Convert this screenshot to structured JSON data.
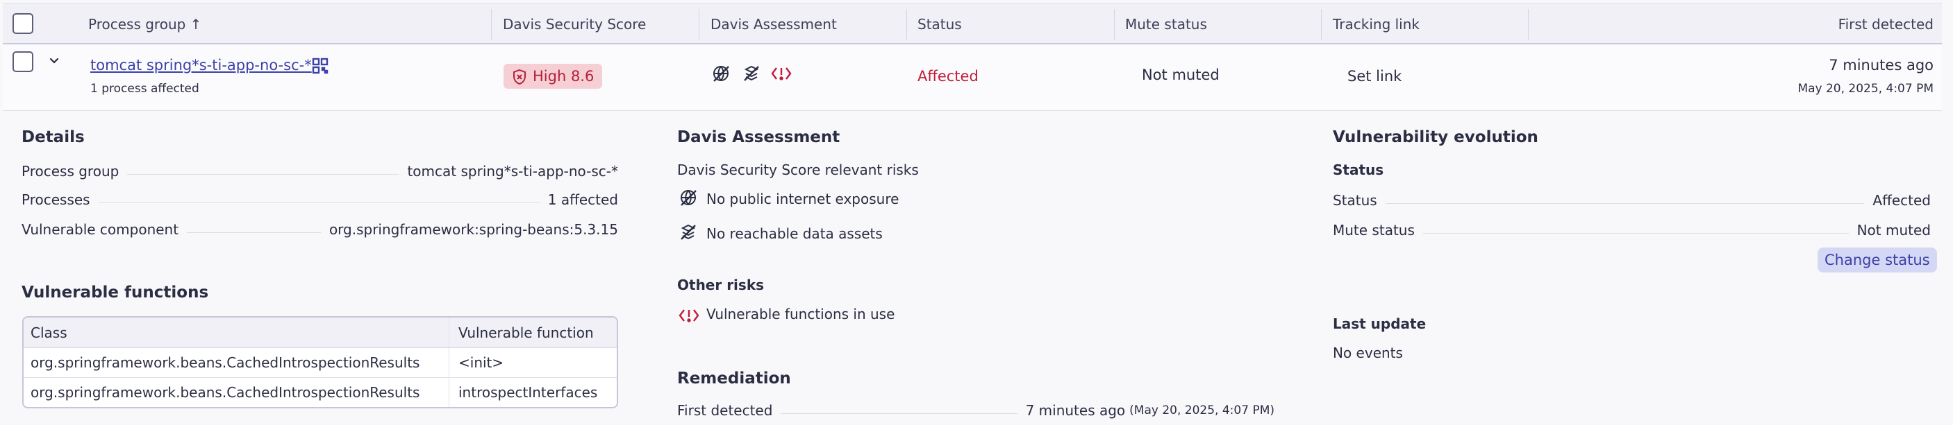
{
  "table": {
    "columns": {
      "process_group": "Process group ↑",
      "score": "Davis Security Score",
      "assessment": "Davis Assessment",
      "status": "Status",
      "mute": "Mute status",
      "tracking": "Tracking link",
      "first_detected": "First detected"
    },
    "row": {
      "name": "tomcat spring*s-ti-app-no-sc-*",
      "processes": "1 process affected",
      "score_label": "High 8.6",
      "status": "Affected",
      "mute": "Not muted",
      "tracking": "Set link",
      "detected_relative": "7 minutes ago",
      "detected_date": "May 20, 2025, 4:07 PM"
    }
  },
  "details": {
    "title": "Details",
    "process_group_label": "Process group",
    "process_group_value": "tomcat spring*s-ti-app-no-sc-*",
    "processes_label": "Processes",
    "processes_value": "1 affected",
    "component_label": "Vulnerable component",
    "component_value": "org.springframework:spring-beans:5.3.15"
  },
  "functions": {
    "title": "Vulnerable functions",
    "col_class": "Class",
    "col_function": "Vulnerable function",
    "rows": [
      {
        "class": "org.springframework.beans.CachedIntrospectionResults",
        "function": "<init>"
      },
      {
        "class": "org.springframework.beans.CachedIntrospectionResults",
        "function": "introspectInterfaces"
      }
    ]
  },
  "assessment": {
    "title": "Davis Assessment",
    "relevant": "Davis Security Score relevant risks",
    "risk1": "No public internet exposure",
    "risk2": "No reachable data assets",
    "other_title": "Other risks",
    "other1": "Vulnerable functions in use"
  },
  "remediation": {
    "title": "Remediation",
    "first_label": "First detected",
    "first_value": "7 minutes ago",
    "first_date": "(May 20, 2025, 4:07 PM)"
  },
  "evolution": {
    "title": "Vulnerability evolution",
    "status_title": "Status",
    "status_label": "Status",
    "status_value": "Affected",
    "mute_label": "Mute status",
    "mute_value": "Not muted",
    "change_button": "Change status",
    "last_update_title": "Last update",
    "last_update_value": "No events"
  },
  "colors": {
    "accent": "#3b41a8",
    "danger": "#c01c36",
    "badge_bg": "#f6cfd5"
  }
}
